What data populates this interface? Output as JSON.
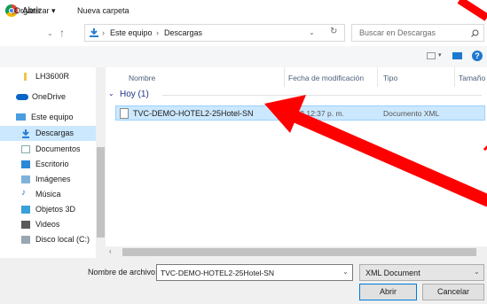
{
  "window": {
    "title": "Abrir"
  },
  "nav": {
    "back_icon": "back-arrow-icon",
    "forward_icon": "forward-arrow-icon",
    "recent_icon": "chevron-down-icon",
    "up_icon": "up-arrow-icon",
    "breadcrumb": [
      "Este equipo",
      "Descargas"
    ],
    "separator": "›",
    "search_placeholder": "Buscar en Descargas"
  },
  "toolbar": {
    "organize_label": "Organizar ▾",
    "new_folder_label": "Nueva carpeta"
  },
  "sidebar": {
    "items": [
      {
        "label": "LH3600R",
        "icon": "folder-icon"
      },
      {
        "label": "OneDrive",
        "icon": "cloud-icon"
      },
      {
        "label": "Este equipo",
        "icon": "computer-icon"
      },
      {
        "label": "Descargas",
        "icon": "download-icon"
      },
      {
        "label": "Documentos",
        "icon": "documents-icon"
      },
      {
        "label": "Escritorio",
        "icon": "desktop-icon"
      },
      {
        "label": "Imágenes",
        "icon": "pictures-icon"
      },
      {
        "label": "Música",
        "icon": "music-icon"
      },
      {
        "label": "Objetos 3D",
        "icon": "3d-objects-icon"
      },
      {
        "label": "Videos",
        "icon": "videos-icon"
      },
      {
        "label": "Disco local (C:)",
        "icon": "drive-icon"
      }
    ]
  },
  "columns": {
    "name": "Nombre",
    "date": "Fecha de modificación",
    "type": "Tipo",
    "size": "Tamaño"
  },
  "group": {
    "label": "Hoy (1)"
  },
  "files": [
    {
      "name": "TVC-DEMO-HOTEL2-25Hotel-SN",
      "date": "0/2023 12:37 p. m.",
      "type": "Documento XML"
    }
  ],
  "footer": {
    "filename_label": "Nombre de archivo:",
    "filename_value": "TVC-DEMO-HOTEL2-25Hotel-SN",
    "filetype_value": "XML Document",
    "open_label": "Abrir",
    "cancel_label": "Cancelar"
  },
  "colors": {
    "selection": "#cce8ff",
    "annotation": "#ff0000",
    "accent": "#0078d7"
  }
}
